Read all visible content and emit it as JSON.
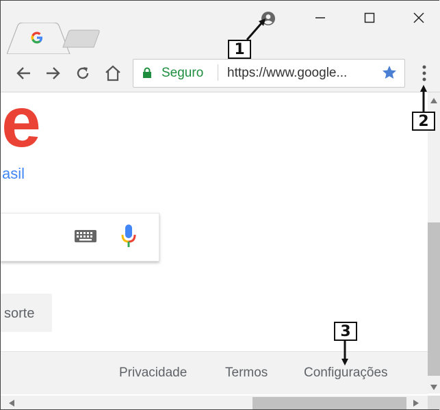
{
  "window": {
    "minimize_glyph": "—",
    "maximize_glyph": "☐",
    "close_glyph": "✕"
  },
  "tabs": [
    {
      "icon": "google-favicon-icon",
      "active": true,
      "label": "G"
    },
    {
      "icon": "new-tab-icon",
      "active": false
    }
  ],
  "toolbar": {
    "back_icon": "back-arrow-icon",
    "forward_icon": "forward-arrow-icon",
    "reload_icon": "reload-icon",
    "home_icon": "home-icon",
    "secure_label": "Seguro",
    "url": "https://www.google...",
    "bookmark_icon": "star-icon",
    "menu_icon": "three-dot-menu-icon"
  },
  "page": {
    "logo_fragment": "e",
    "region_label": "asil",
    "lucky_button_fragment": "sorte",
    "footer_links": [
      "Privacidade",
      "Termos",
      "Configurações"
    ]
  },
  "callouts": [
    "1",
    "2",
    "3"
  ],
  "colors": {
    "secure_green": "#1e8e3e",
    "google_red": "#ea4335",
    "google_blue": "#4285f4",
    "star_blue": "#4a7fd4",
    "chrome_gray": "#f2f2f2"
  }
}
